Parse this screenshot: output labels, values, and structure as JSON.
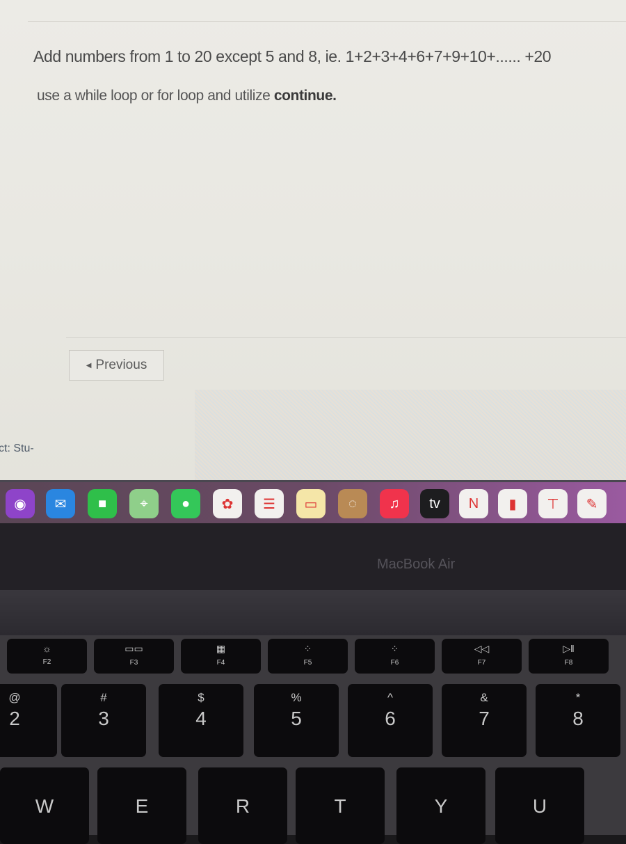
{
  "page": {
    "question_line1": "Add numbers from 1 to 20 except 5 and 8, ie. 1+2+3+4+6+7+9+10+...... +20",
    "question_line2_prefix": "use a while loop or for loop and utilize ",
    "question_line2_bold": "continue.",
    "previous_button": "Previous",
    "side_text": "ct: Stu-"
  },
  "dock": {
    "items": [
      {
        "name": "Podcasts",
        "glyph": "◉",
        "color": "#8e44c9"
      },
      {
        "name": "Mail",
        "glyph": "✉",
        "color": "#2a86e0"
      },
      {
        "name": "FaceTime",
        "glyph": "■",
        "color": "#2fbf4a"
      },
      {
        "name": "Maps",
        "glyph": "⌖",
        "color": "#8fcf8a"
      },
      {
        "name": "Messages",
        "glyph": "●",
        "color": "#34c759"
      },
      {
        "name": "Photos",
        "glyph": "✿",
        "color": "#f2f0ee"
      },
      {
        "name": "Reminders",
        "glyph": "☰",
        "color": "#f2f0ee"
      },
      {
        "name": "Notes",
        "glyph": "▭",
        "color": "#f5e6a8"
      },
      {
        "name": "Contacts",
        "glyph": "◌",
        "color": "#b98a55"
      },
      {
        "name": "Music",
        "glyph": "♫",
        "color": "#f0334c"
      },
      {
        "name": "TV",
        "glyph": "tv",
        "color": "#1d1d1f"
      },
      {
        "name": "News",
        "glyph": "N",
        "color": "#f2f0ee"
      },
      {
        "name": "Numbers",
        "glyph": "▮",
        "color": "#f2f0ee"
      },
      {
        "name": "Keynote",
        "glyph": "⊤",
        "color": "#f2f0ee"
      },
      {
        "name": "Pages",
        "glyph": "✎",
        "color": "#f2f0ee"
      }
    ]
  },
  "device": {
    "brand": "MacBook Air"
  },
  "keyboard": {
    "fkeys": [
      {
        "sym": "☼",
        "label": "F2"
      },
      {
        "sym": "▭▭",
        "label": "F3"
      },
      {
        "sym": "▦",
        "label": "F4"
      },
      {
        "sym": "⁘",
        "label": "F5"
      },
      {
        "sym": "⁘",
        "label": "F6"
      },
      {
        "sym": "◁◁",
        "label": "F7"
      },
      {
        "sym": "▷‖",
        "label": "F8"
      }
    ],
    "numkeys": [
      {
        "top": "@",
        "bot": "2"
      },
      {
        "top": "#",
        "bot": "3"
      },
      {
        "top": "$",
        "bot": "4"
      },
      {
        "top": "%",
        "bot": "5"
      },
      {
        "top": "^",
        "bot": "6"
      },
      {
        "top": "&",
        "bot": "7"
      },
      {
        "top": "*",
        "bot": "8"
      }
    ],
    "letterkeys": [
      "W",
      "E",
      "R",
      "T",
      "Y",
      "U"
    ]
  }
}
